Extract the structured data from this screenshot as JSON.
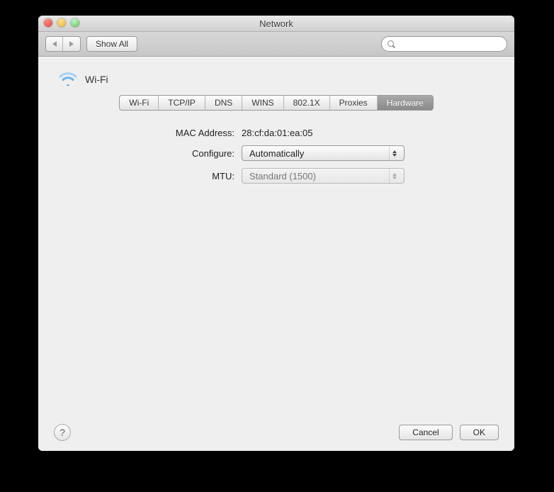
{
  "window": {
    "title": "Network"
  },
  "toolbar": {
    "show_all_label": "Show All",
    "search_placeholder": ""
  },
  "connection": {
    "name": "Wi-Fi"
  },
  "tabs": [
    {
      "label": "Wi-Fi"
    },
    {
      "label": "TCP/IP"
    },
    {
      "label": "DNS"
    },
    {
      "label": "WINS"
    },
    {
      "label": "802.1X"
    },
    {
      "label": "Proxies"
    },
    {
      "label": "Hardware"
    }
  ],
  "active_tab": "Hardware",
  "hardware": {
    "mac_label": "MAC Address:",
    "mac_value": "28:cf:da:01:ea:05",
    "configure_label": "Configure:",
    "configure_value": "Automatically",
    "mtu_label": "MTU:",
    "mtu_value": "Standard  (1500)",
    "mtu_enabled": false
  },
  "footer": {
    "help_tooltip": "?",
    "cancel_label": "Cancel",
    "ok_label": "OK"
  }
}
